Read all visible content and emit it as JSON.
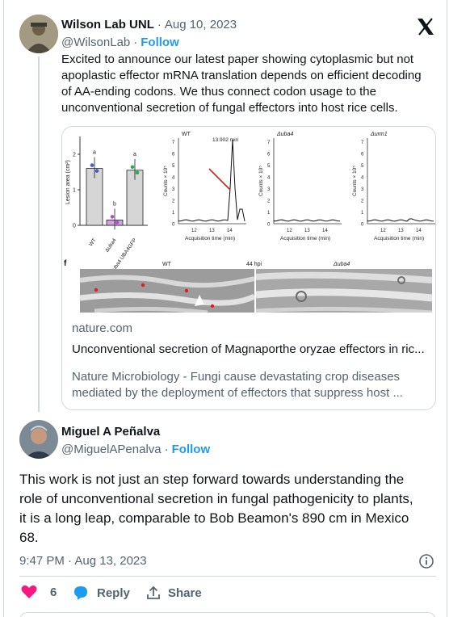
{
  "post1": {
    "author": "Wilson Lab UNL",
    "date": "Aug 10, 2023",
    "handle": "@WilsonLab",
    "follow": "Follow",
    "text": "Excited to announce our latest paper showing cytoplasmic but not apoplastic effector mRNA translation depends on efficient decoding of AA-ending codons.  We thus connect codon usage to the unconventional secretion of fungal effectors into host rice cells.",
    "card": {
      "domain": "nature.com",
      "title": "Unconventional secretion of Magnaporthe oryzae effectors in ric...",
      "description": "Nature Microbiology - Fungi cause devastating crop diseases mediated by the deployment of effectors that suppress host ...",
      "figure": {
        "bar_ylabel": "Lesion area (cm²)",
        "bar_ticks": [
          "0",
          "1",
          "2"
        ],
        "bar_groups": [
          "a",
          "b",
          "a"
        ],
        "bar_categories": [
          "WT",
          "Δuba4",
          "Δuba4 UBA4GFP"
        ],
        "bar_values": [
          1.6,
          0.15,
          1.55
        ],
        "panel1_title": "WT",
        "panel2_title": "Δuba4",
        "panel3_title": "Δurm1",
        "peak_label": "13.902 min",
        "y_label": "Counts × 10⁵",
        "y_ticks": [
          "0",
          "1",
          "2",
          "3",
          "4",
          "5",
          "6",
          "7"
        ],
        "x_ticks": [
          "12",
          "13",
          "14"
        ],
        "x_label": "Acquisition time (min)",
        "panel_f": "f",
        "micro_left": "WT",
        "micro_time": "44 hpi",
        "micro_right": "Δuba4"
      }
    }
  },
  "post2": {
    "author": "Miguel A Peñalva",
    "handle": "@MiguelAPenalva",
    "follow": "Follow",
    "text": "This work is not just an step forward towards understanding the role of unconventional secretion in fungal pathogenicity to plants, it is a long leap, comparable to Bob Beamon's 890 cm in Mexico 68.",
    "timestamp": "9:47 PM · Aug 13, 2023",
    "likes": "6",
    "reply": "Reply",
    "share": "Share"
  },
  "colors": {
    "like": "#f91880",
    "link": "#1d9bf0",
    "reply": "#1d9bf0",
    "muted": "#536471"
  }
}
